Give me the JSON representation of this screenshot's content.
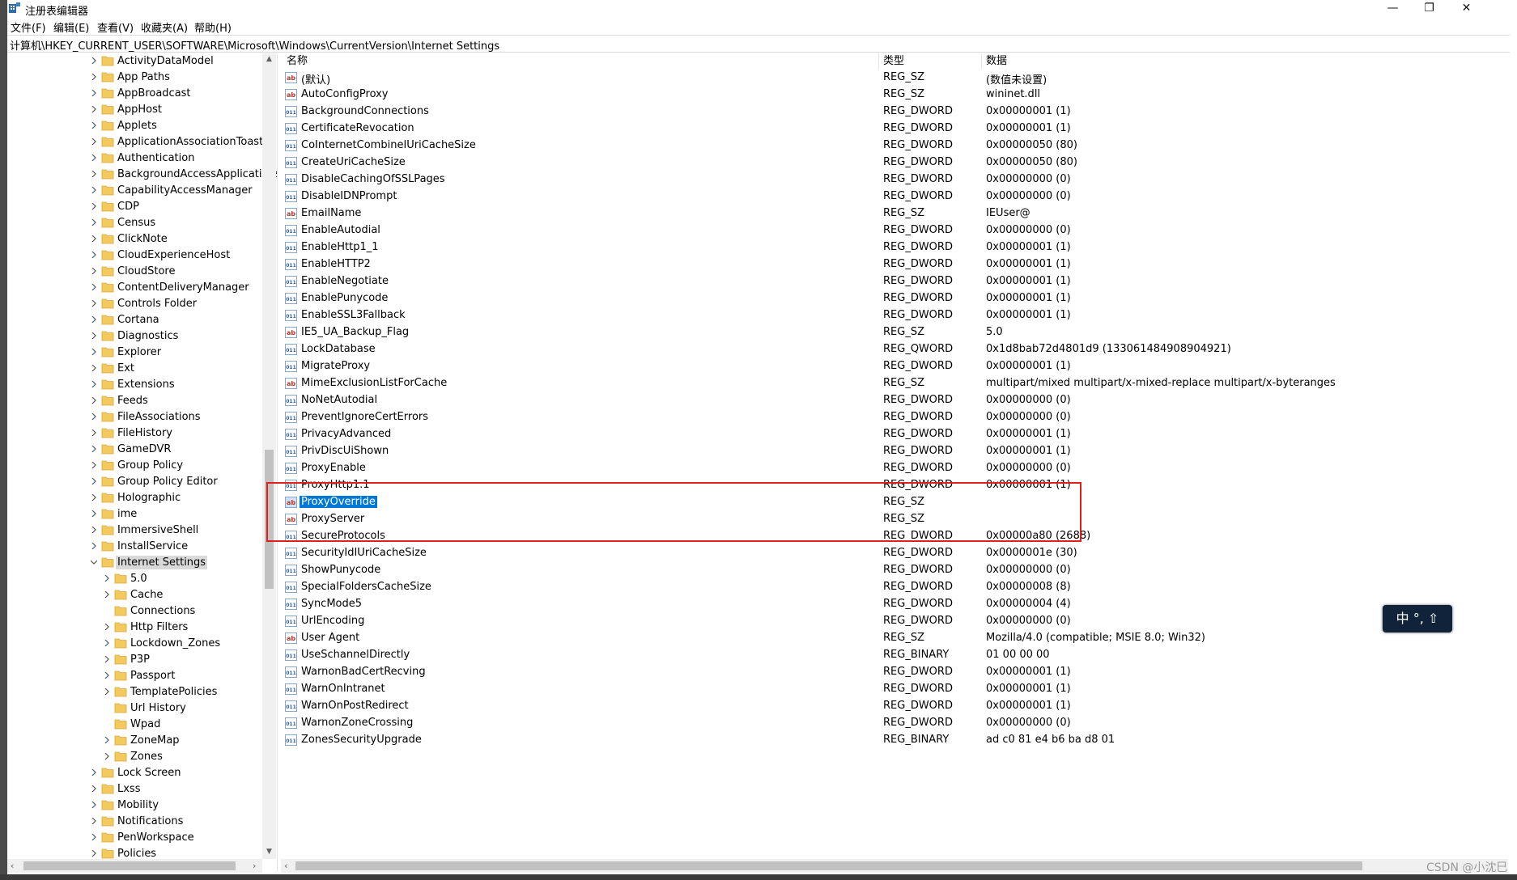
{
  "window": {
    "title": "注册表编辑器",
    "minimize_glyph": "—",
    "maximize_glyph": "❐",
    "close_glyph": "✕"
  },
  "menu": [
    "文件(F)",
    "编辑(E)",
    "查看(V)",
    "收藏夹(A)",
    "帮助(H)"
  ],
  "address": "计算机\\HKEY_CURRENT_USER\\SOFTWARE\\Microsoft\\Windows\\CurrentVersion\\Internet Settings",
  "tree": [
    {
      "label": "ActivityDataModel",
      "level": 0,
      "expandable": true
    },
    {
      "label": "App Paths",
      "level": 0,
      "expandable": true
    },
    {
      "label": "AppBroadcast",
      "level": 0,
      "expandable": true
    },
    {
      "label": "AppHost",
      "level": 0,
      "expandable": true
    },
    {
      "label": "Applets",
      "level": 0,
      "expandable": true
    },
    {
      "label": "ApplicationAssociationToasts",
      "level": 0,
      "expandable": true
    },
    {
      "label": "Authentication",
      "level": 0,
      "expandable": true
    },
    {
      "label": "BackgroundAccessApplications",
      "level": 0,
      "expandable": true
    },
    {
      "label": "CapabilityAccessManager",
      "level": 0,
      "expandable": true
    },
    {
      "label": "CDP",
      "level": 0,
      "expandable": true
    },
    {
      "label": "Census",
      "level": 0,
      "expandable": true
    },
    {
      "label": "ClickNote",
      "level": 0,
      "expandable": true
    },
    {
      "label": "CloudExperienceHost",
      "level": 0,
      "expandable": true
    },
    {
      "label": "CloudStore",
      "level": 0,
      "expandable": true
    },
    {
      "label": "ContentDeliveryManager",
      "level": 0,
      "expandable": true
    },
    {
      "label": "Controls Folder",
      "level": 0,
      "expandable": true
    },
    {
      "label": "Cortana",
      "level": 0,
      "expandable": true
    },
    {
      "label": "Diagnostics",
      "level": 0,
      "expandable": true
    },
    {
      "label": "Explorer",
      "level": 0,
      "expandable": true
    },
    {
      "label": "Ext",
      "level": 0,
      "expandable": true
    },
    {
      "label": "Extensions",
      "level": 0,
      "expandable": true
    },
    {
      "label": "Feeds",
      "level": 0,
      "expandable": true
    },
    {
      "label": "FileAssociations",
      "level": 0,
      "expandable": true
    },
    {
      "label": "FileHistory",
      "level": 0,
      "expandable": true
    },
    {
      "label": "GameDVR",
      "level": 0,
      "expandable": true
    },
    {
      "label": "Group Policy",
      "level": 0,
      "expandable": true
    },
    {
      "label": "Group Policy Editor",
      "level": 0,
      "expandable": true
    },
    {
      "label": "Holographic",
      "level": 0,
      "expandable": true
    },
    {
      "label": "ime",
      "level": 0,
      "expandable": true
    },
    {
      "label": "ImmersiveShell",
      "level": 0,
      "expandable": true
    },
    {
      "label": "InstallService",
      "level": 0,
      "expandable": true
    },
    {
      "label": "Internet Settings",
      "level": 0,
      "expandable": true,
      "expanded": true,
      "selected": true
    },
    {
      "label": "5.0",
      "level": 1,
      "expandable": true
    },
    {
      "label": "Cache",
      "level": 1,
      "expandable": true
    },
    {
      "label": "Connections",
      "level": 1,
      "expandable": false
    },
    {
      "label": "Http Filters",
      "level": 1,
      "expandable": true
    },
    {
      "label": "Lockdown_Zones",
      "level": 1,
      "expandable": true
    },
    {
      "label": "P3P",
      "level": 1,
      "expandable": true
    },
    {
      "label": "Passport",
      "level": 1,
      "expandable": true
    },
    {
      "label": "TemplatePolicies",
      "level": 1,
      "expandable": true
    },
    {
      "label": "Url History",
      "level": 1,
      "expandable": false
    },
    {
      "label": "Wpad",
      "level": 1,
      "expandable": false
    },
    {
      "label": "ZoneMap",
      "level": 1,
      "expandable": true
    },
    {
      "label": "Zones",
      "level": 1,
      "expandable": true
    },
    {
      "label": "Lock Screen",
      "level": 0,
      "expandable": true
    },
    {
      "label": "Lxss",
      "level": 0,
      "expandable": true
    },
    {
      "label": "Mobility",
      "level": 0,
      "expandable": true
    },
    {
      "label": "Notifications",
      "level": 0,
      "expandable": true
    },
    {
      "label": "PenWorkspace",
      "level": 0,
      "expandable": true
    },
    {
      "label": "Policies",
      "level": 0,
      "expandable": true
    }
  ],
  "columns": {
    "name": "名称",
    "type": "类型",
    "data": "数据"
  },
  "values": [
    {
      "icon": "string-icon",
      "name": "(默认)",
      "type": "REG_SZ",
      "data": "(数值未设置)"
    },
    {
      "icon": "string-icon",
      "name": "AutoConfigProxy",
      "type": "REG_SZ",
      "data": "wininet.dll"
    },
    {
      "icon": "binary-icon",
      "name": "BackgroundConnections",
      "type": "REG_DWORD",
      "data": "0x00000001 (1)"
    },
    {
      "icon": "binary-icon",
      "name": "CertificateRevocation",
      "type": "REG_DWORD",
      "data": "0x00000001 (1)"
    },
    {
      "icon": "binary-icon",
      "name": "CoInternetCombineIUriCacheSize",
      "type": "REG_DWORD",
      "data": "0x00000050 (80)"
    },
    {
      "icon": "binary-icon",
      "name": "CreateUriCacheSize",
      "type": "REG_DWORD",
      "data": "0x00000050 (80)"
    },
    {
      "icon": "binary-icon",
      "name": "DisableCachingOfSSLPages",
      "type": "REG_DWORD",
      "data": "0x00000000 (0)"
    },
    {
      "icon": "binary-icon",
      "name": "DisableIDNPrompt",
      "type": "REG_DWORD",
      "data": "0x00000000 (0)"
    },
    {
      "icon": "string-icon",
      "name": "EmailName",
      "type": "REG_SZ",
      "data": "IEUser@"
    },
    {
      "icon": "binary-icon",
      "name": "EnableAutodial",
      "type": "REG_DWORD",
      "data": "0x00000000 (0)"
    },
    {
      "icon": "binary-icon",
      "name": "EnableHttp1_1",
      "type": "REG_DWORD",
      "data": "0x00000001 (1)"
    },
    {
      "icon": "binary-icon",
      "name": "EnableHTTP2",
      "type": "REG_DWORD",
      "data": "0x00000001 (1)"
    },
    {
      "icon": "binary-icon",
      "name": "EnableNegotiate",
      "type": "REG_DWORD",
      "data": "0x00000001 (1)"
    },
    {
      "icon": "binary-icon",
      "name": "EnablePunycode",
      "type": "REG_DWORD",
      "data": "0x00000001 (1)"
    },
    {
      "icon": "binary-icon",
      "name": "EnableSSL3Fallback",
      "type": "REG_DWORD",
      "data": "0x00000001 (1)"
    },
    {
      "icon": "string-icon",
      "name": "IE5_UA_Backup_Flag",
      "type": "REG_SZ",
      "data": "5.0"
    },
    {
      "icon": "binary-icon",
      "name": "LockDatabase",
      "type": "REG_QWORD",
      "data": "0x1d8bab72d4801d9 (133061484908904921)"
    },
    {
      "icon": "binary-icon",
      "name": "MigrateProxy",
      "type": "REG_DWORD",
      "data": "0x00000001 (1)"
    },
    {
      "icon": "string-icon",
      "name": "MimeExclusionListForCache",
      "type": "REG_SZ",
      "data": "multipart/mixed multipart/x-mixed-replace multipart/x-byteranges"
    },
    {
      "icon": "binary-icon",
      "name": "NoNetAutodial",
      "type": "REG_DWORD",
      "data": "0x00000000 (0)"
    },
    {
      "icon": "binary-icon",
      "name": "PreventIgnoreCertErrors",
      "type": "REG_DWORD",
      "data": "0x00000000 (0)"
    },
    {
      "icon": "binary-icon",
      "name": "PrivacyAdvanced",
      "type": "REG_DWORD",
      "data": "0x00000001 (1)"
    },
    {
      "icon": "binary-icon",
      "name": "PrivDiscUiShown",
      "type": "REG_DWORD",
      "data": "0x00000001 (1)"
    },
    {
      "icon": "binary-icon",
      "name": "ProxyEnable",
      "type": "REG_DWORD",
      "data": "0x00000000 (0)"
    },
    {
      "icon": "binary-icon",
      "name": "ProxyHttp1.1",
      "type": "REG_DWORD",
      "data": "0x00000001 (1)"
    },
    {
      "icon": "string-icon",
      "name": "ProxyOverride",
      "type": "REG_SZ",
      "data": "",
      "selected": true
    },
    {
      "icon": "string-icon",
      "name": "ProxyServer",
      "type": "REG_SZ",
      "data": ""
    },
    {
      "icon": "binary-icon",
      "name": "SecureProtocols",
      "type": "REG_DWORD",
      "data": "0x00000a80 (2688)"
    },
    {
      "icon": "binary-icon",
      "name": "SecurityIdIUriCacheSize",
      "type": "REG_DWORD",
      "data": "0x0000001e (30)"
    },
    {
      "icon": "binary-icon",
      "name": "ShowPunycode",
      "type": "REG_DWORD",
      "data": "0x00000000 (0)"
    },
    {
      "icon": "binary-icon",
      "name": "SpecialFoldersCacheSize",
      "type": "REG_DWORD",
      "data": "0x00000008 (8)"
    },
    {
      "icon": "binary-icon",
      "name": "SyncMode5",
      "type": "REG_DWORD",
      "data": "0x00000004 (4)"
    },
    {
      "icon": "binary-icon",
      "name": "UrlEncoding",
      "type": "REG_DWORD",
      "data": "0x00000000 (0)"
    },
    {
      "icon": "string-icon",
      "name": "User Agent",
      "type": "REG_SZ",
      "data": "Mozilla/4.0 (compatible; MSIE 8.0; Win32)"
    },
    {
      "icon": "binary-icon",
      "name": "UseSchannelDirectly",
      "type": "REG_BINARY",
      "data": "01 00 00 00"
    },
    {
      "icon": "binary-icon",
      "name": "WarnonBadCertRecving",
      "type": "REG_DWORD",
      "data": "0x00000001 (1)"
    },
    {
      "icon": "binary-icon",
      "name": "WarnOnIntranet",
      "type": "REG_DWORD",
      "data": "0x00000001 (1)"
    },
    {
      "icon": "binary-icon",
      "name": "WarnOnPostRedirect",
      "type": "REG_DWORD",
      "data": "0x00000001 (1)"
    },
    {
      "icon": "binary-icon",
      "name": "WarnonZoneCrossing",
      "type": "REG_DWORD",
      "data": "0x00000000 (0)"
    },
    {
      "icon": "binary-icon",
      "name": "ZonesSecurityUpgrade",
      "type": "REG_BINARY",
      "data": "ad c0 81 e4 b6 ba d8 01"
    }
  ],
  "ime": {
    "text": "中 °, ⇧"
  },
  "watermark": "CSDN @小沈巳",
  "colors": {
    "selection": "#0078d7",
    "folder": "#f4c95d",
    "annotation_box": "#e0201d"
  }
}
